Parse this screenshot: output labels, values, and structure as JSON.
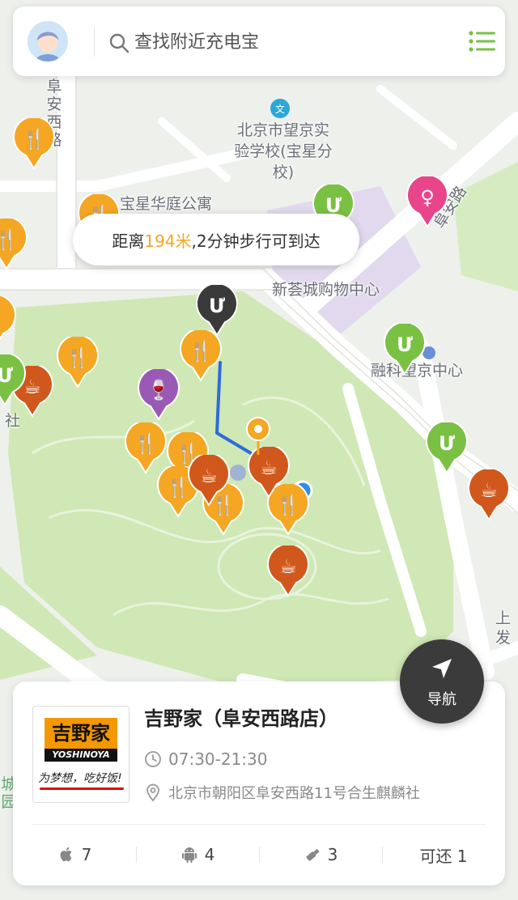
{
  "search": {
    "placeholder": "查找附近充电宝"
  },
  "bubble": {
    "prefix": "距离",
    "distance": "194米",
    "suffix": ",2分钟步行可到达"
  },
  "map_labels": {
    "road_fuan_west": "阜安西路",
    "school": "北京市望京实验学校(宝星分校)",
    "apartment": "宝星华庭公寓",
    "road_fuan": "阜安路",
    "mall": "新荟城购物中心",
    "office": "融科望京中心",
    "she": "社",
    "right_edge_top": "上",
    "right_edge_bottom": "发",
    "left_edge": "城 园"
  },
  "navigation": {
    "label": "导航"
  },
  "store": {
    "name": "吉野家（阜安西路店）",
    "hours": "07:30-21:30",
    "address": "北京市朝阳区阜安西路11号合生麒麟社",
    "logo_text": "吉野家",
    "logo_latin": "YOSHINOYA",
    "logo_slogan": "为梦想，吃好饭!",
    "counts": {
      "apple": "7",
      "android": "4",
      "usb": "3",
      "return": "可还 1"
    }
  },
  "colors": {
    "pin_food": "#f5a623",
    "pin_cafe": "#d0581c",
    "pin_charger": "#7ac143",
    "pin_bar": "#9b59b6",
    "pin_beauty": "#e8458b",
    "pin_selected": "#3a3a3a",
    "route": "#2f6bd9",
    "accent": "#f5a623"
  }
}
